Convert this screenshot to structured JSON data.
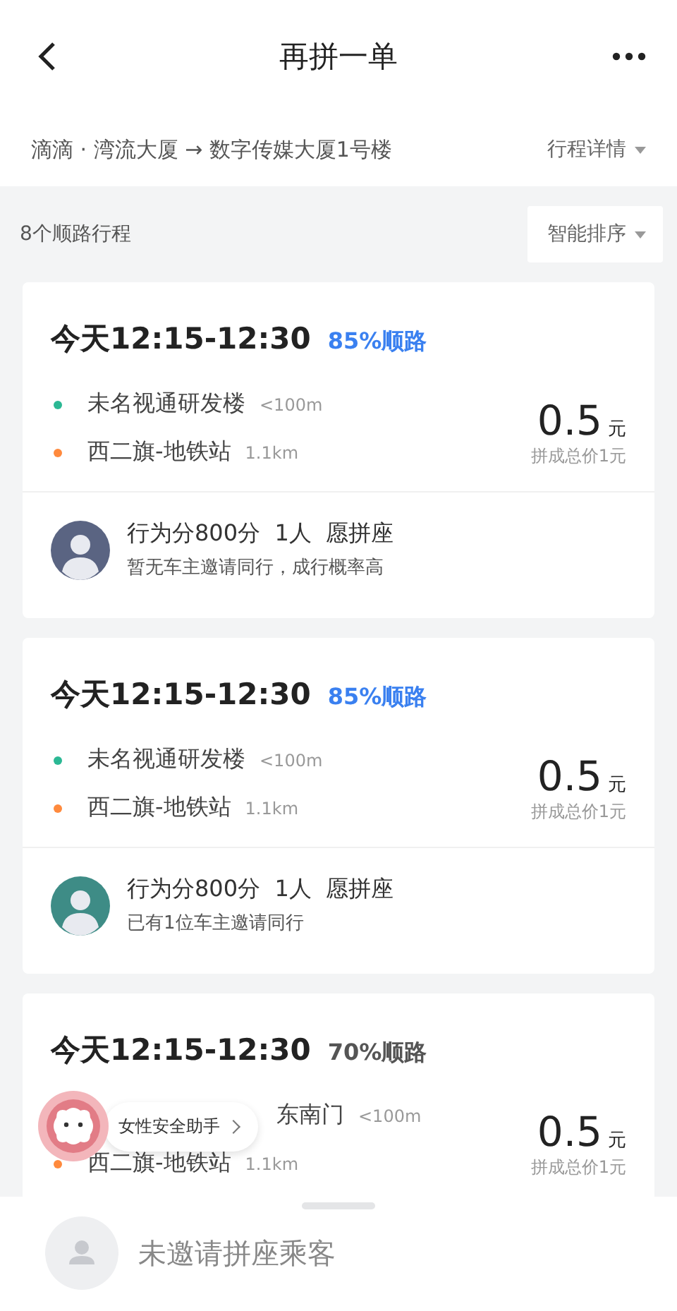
{
  "header": {
    "title": "再拼一单"
  },
  "route": {
    "text": "滴滴 · 湾流大厦 → 数字传媒大厦1号楼",
    "detail_link": "行程详情"
  },
  "list_header": {
    "count": "8个顺路行程",
    "sort": "智能排序"
  },
  "cards": [
    {
      "time": "今天12:15-12:30",
      "match": "85%顺路",
      "match_highlight": true,
      "stops": [
        {
          "kind": "pickup",
          "name": "未名视通研发楼",
          "distance": "<100m",
          "obscured": false
        },
        {
          "kind": "dropoff",
          "name": "西二旗-地铁站",
          "distance": "1.1km",
          "obscured": false
        }
      ],
      "price": "0.5",
      "unit": "元",
      "total": "拼成总价1元",
      "passenger": {
        "color": "#5a6482",
        "info": "行为分800分  1人  愿拼座",
        "note": "暂无车主邀请同行，成行概率高"
      }
    },
    {
      "time": "今天12:15-12:30",
      "match": "85%顺路",
      "match_highlight": true,
      "stops": [
        {
          "kind": "pickup",
          "name": "未名视通研发楼",
          "distance": "<100m",
          "obscured": false
        },
        {
          "kind": "dropoff",
          "name": "西二旗-地铁站",
          "distance": "1.1km",
          "obscured": false
        }
      ],
      "price": "0.5",
      "unit": "元",
      "total": "拼成总价1元",
      "passenger": {
        "color": "#3e8c86",
        "info": "行为分800分  1人  愿拼座",
        "note": "已有1位车主邀请同行"
      }
    },
    {
      "time": "今天12:15-12:30",
      "match": "70%顺路",
      "match_highlight": false,
      "stops": [
        {
          "name": "东南门",
          "distance": "<100m",
          "obscured": true
        },
        {
          "kind": "dropoff",
          "name": "西二旗-地铁站",
          "distance": "1.1km",
          "obscured": false
        }
      ],
      "price": "0.5",
      "unit": "元",
      "total": "拼成总价1元"
    }
  ],
  "assistant": {
    "label": "女性安全助手"
  },
  "bottom_sheet": {
    "text": "未邀请拼座乘客"
  }
}
